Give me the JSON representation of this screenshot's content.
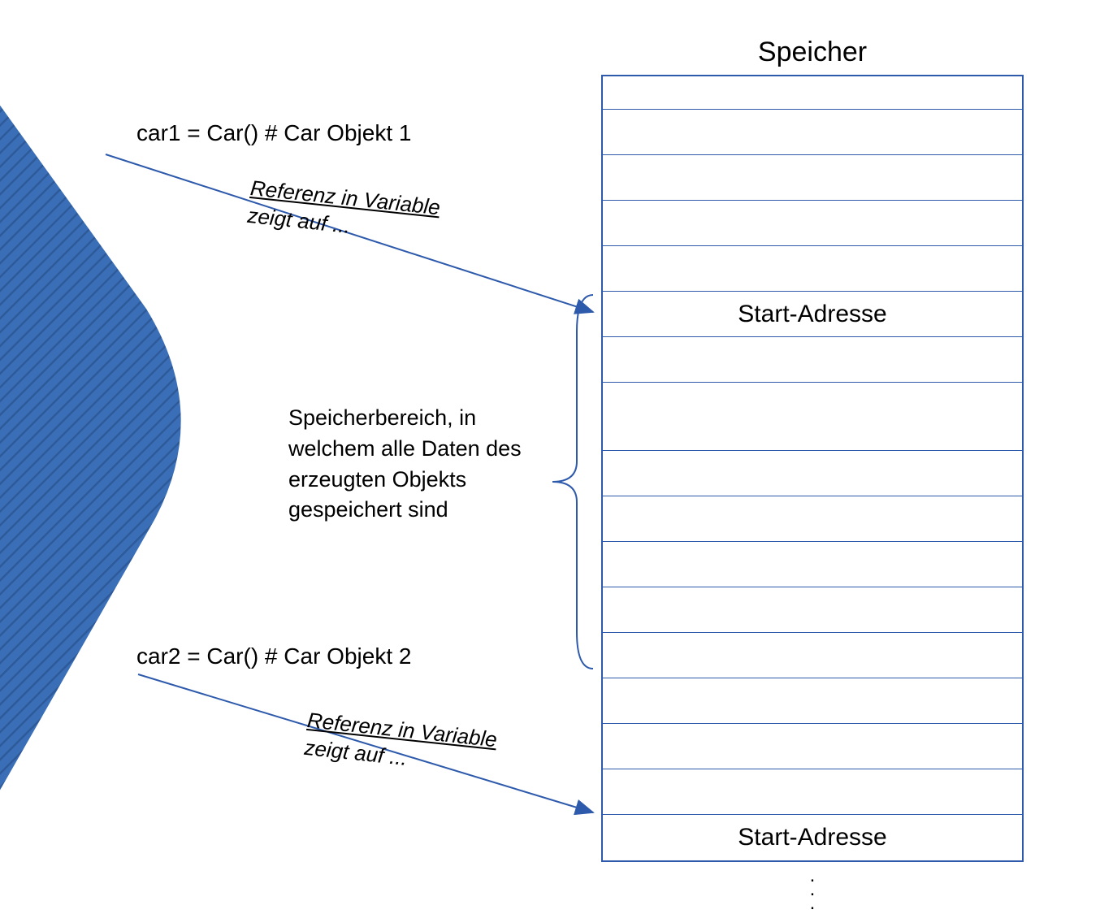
{
  "heading": "Speicher",
  "code1": "car1 = Car()    # Car Objekt 1",
  "code2": "car2 = Car()    # Car Objekt 2",
  "arrow_label_line1": "Referenz in Variable",
  "arrow_label_line2": "zeigt auf ...",
  "description": "Speicherbereich, in welchem alle Daten des erzeugten Objekts gespeichert sind",
  "cell_start_address": "Start-Adresse",
  "memory": {
    "rows": 17,
    "start_address_rows": [
      5,
      16
    ]
  },
  "colors": {
    "blue_shape": "#3a6fb7",
    "border": "#2e5aac",
    "arrow": "#2e5aac"
  }
}
